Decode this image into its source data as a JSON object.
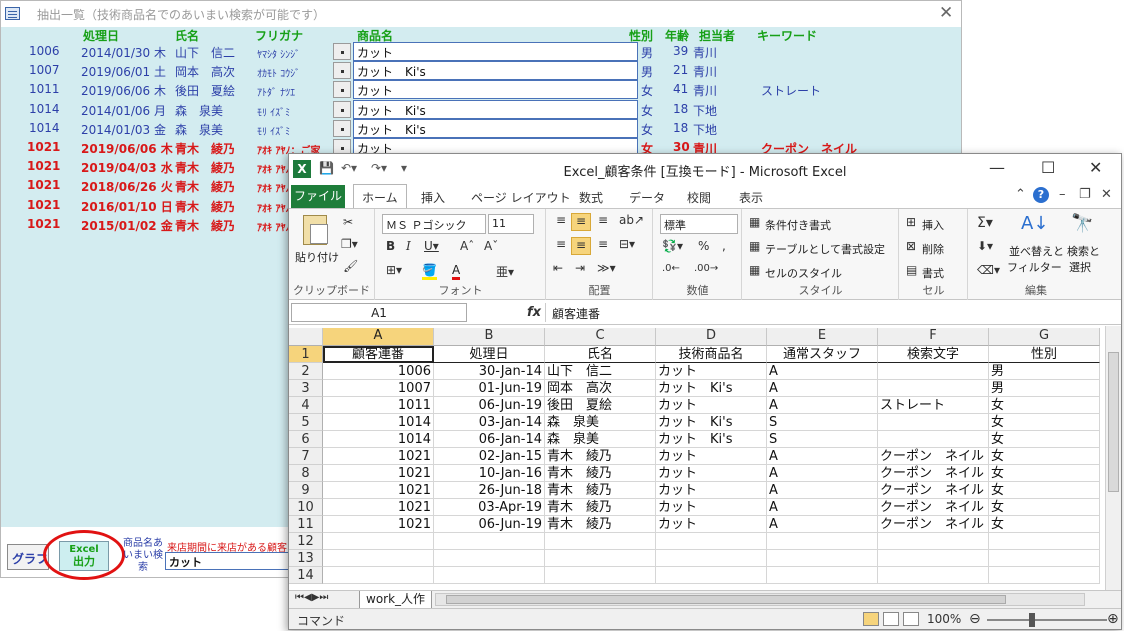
{
  "access": {
    "title": "抽出一覧（技術商品名でのあいまい検索が可能です）",
    "headers": {
      "date": "処理日",
      "name": "氏名",
      "kana": "フリガナ",
      "product": "商品名",
      "gender": "性別",
      "age": "年齢",
      "staff": "担当者",
      "keyword": "キーワード"
    },
    "rows": [
      {
        "id": "1006",
        "date": "2014/01/30 木",
        "name": "山下　信二",
        "kana": "ﾔﾏｼﾀ ｼﾝｼﾞ",
        "product": "カット",
        "gender": "男",
        "age": "39",
        "staff": "青川",
        "keyword": "",
        "style": "blue"
      },
      {
        "id": "1007",
        "date": "2019/06/01 土",
        "name": "岡本　高次",
        "kana": "ｵｶﾓﾄ ｺｳｼﾞ",
        "product": "カット　Ki's",
        "gender": "男",
        "age": "21",
        "staff": "青川",
        "keyword": "",
        "style": "blue"
      },
      {
        "id": "1011",
        "date": "2019/06/06 木",
        "name": "後田　夏絵",
        "kana": "ｱﾄﾀﾞ ﾅﾂｴ",
        "product": "カット",
        "gender": "女",
        "age": "41",
        "staff": "青川",
        "keyword": "ストレート",
        "style": "blue"
      },
      {
        "id": "1014",
        "date": "2014/01/06 月",
        "name": "森　泉美",
        "kana": "ﾓﾘ ｲｽﾞﾐ",
        "product": "カット　Ki's",
        "gender": "女",
        "age": "18",
        "staff": "下地",
        "keyword": "",
        "style": "blue"
      },
      {
        "id": "1014",
        "date": "2014/01/03 金",
        "name": "森　泉美",
        "kana": "ﾓﾘ ｲｽﾞﾐ",
        "product": "カット　Ki's",
        "gender": "女",
        "age": "18",
        "staff": "下地",
        "keyword": "",
        "style": "blue"
      },
      {
        "id": "1021",
        "date": "2019/06/06 木",
        "name": "青木　綾乃",
        "kana": "ｱｵｷ ｱﾔﾉ：ご家",
        "product": "カット",
        "gender": "女",
        "age": "30",
        "staff": "青川",
        "keyword": "クーポン　ネイル",
        "style": "red"
      },
      {
        "id": "1021",
        "date": "2019/04/03 水",
        "name": "青木　綾乃",
        "kana": "ｱｵｷ ｱﾔﾉ",
        "product": "",
        "gender": "",
        "age": "",
        "staff": "",
        "keyword": "",
        "style": "red"
      },
      {
        "id": "1021",
        "date": "2018/06/26 火",
        "name": "青木　綾乃",
        "kana": "ｱｵｷ ｱﾔﾉ",
        "product": "",
        "gender": "",
        "age": "",
        "staff": "",
        "keyword": "",
        "style": "red"
      },
      {
        "id": "1021",
        "date": "2016/01/10 日",
        "name": "青木　綾乃",
        "kana": "ｱｵｷ ｱﾔﾉ",
        "product": "",
        "gender": "",
        "age": "",
        "staff": "",
        "keyword": "",
        "style": "red"
      },
      {
        "id": "1021",
        "date": "2015/01/02 金",
        "name": "青木　綾乃",
        "kana": "ｱｵｷ ｱﾔﾉ",
        "product": "",
        "gender": "",
        "age": "",
        "staff": "",
        "keyword": "",
        "style": "red"
      }
    ],
    "footer": {
      "graph_label": "グラフ",
      "excel_label_line1": "Excel",
      "excel_label_line2": "出力",
      "side_label": "商品名あいまい検索",
      "note": "来店期間に来店がある顧客",
      "search_value": "カット"
    }
  },
  "excel": {
    "logo": "X",
    "title": "Excel_顧客条件 [互換モード] - Microsoft Excel",
    "tabs": [
      "ファイル",
      "ホーム",
      "挿入",
      "ページ レイアウト",
      "数式",
      "データ",
      "校閲",
      "表示"
    ],
    "ribbon": {
      "clipboard": {
        "label": "クリップボード",
        "paste": "貼り付け"
      },
      "font": {
        "label": "フォント",
        "font_name": "ＭＳ Ｐゴシック",
        "font_size": "11"
      },
      "alignment": {
        "label": "配置"
      },
      "number": {
        "label": "数値",
        "format": "標準"
      },
      "styles": {
        "label": "スタイル",
        "cond_format": "条件付き書式",
        "table_format": "テーブルとして書式設定",
        "cell_style": "セルのスタイル"
      },
      "cells": {
        "label": "セル",
        "insert": "挿入",
        "delete": "削除",
        "format": "書式"
      },
      "editing": {
        "label": "編集",
        "sort_filter_1": "並べ替えと",
        "sort_filter_2": "フィルター",
        "find_select_1": "検索と",
        "find_select_2": "選択"
      }
    },
    "namebox": "A1",
    "fx": "fx",
    "formula_value": "顧客連番",
    "columns": [
      "A",
      "B",
      "C",
      "D",
      "E",
      "F",
      "G"
    ],
    "row_numbers": [
      "1",
      "2",
      "3",
      "4",
      "5",
      "6",
      "7",
      "8",
      "9",
      "10",
      "11",
      "12",
      "13",
      "14"
    ],
    "header_row": [
      "顧客連番",
      "処理日",
      "氏名",
      "技術商品名",
      "通常スタッフ",
      "検索文字",
      "性別"
    ],
    "data_rows": [
      [
        "1006",
        "30-Jan-14",
        "山下　信二",
        "カット",
        "A",
        "",
        "男"
      ],
      [
        "1007",
        "01-Jun-19",
        "岡本　高次",
        "カット　Ki's",
        "A",
        "",
        "男"
      ],
      [
        "1011",
        "06-Jun-19",
        "後田　夏絵",
        "カット",
        "A",
        "ストレート",
        "女"
      ],
      [
        "1014",
        "03-Jan-14",
        "森　泉美",
        "カット　Ki's",
        "S",
        "",
        "女"
      ],
      [
        "1014",
        "06-Jan-14",
        "森　泉美",
        "カット　Ki's",
        "S",
        "",
        "女"
      ],
      [
        "1021",
        "02-Jan-15",
        "青木　綾乃",
        "カット",
        "A",
        "クーポン　ネイル",
        "女"
      ],
      [
        "1021",
        "10-Jan-16",
        "青木　綾乃",
        "カット",
        "A",
        "クーポン　ネイル",
        "女"
      ],
      [
        "1021",
        "26-Jun-18",
        "青木　綾乃",
        "カット",
        "A",
        "クーポン　ネイル",
        "女"
      ],
      [
        "1021",
        "03-Apr-19",
        "青木　綾乃",
        "カット",
        "A",
        "クーポン　ネイル",
        "女"
      ],
      [
        "1021",
        "06-Jun-19",
        "青木　綾乃",
        "カット",
        "A",
        "クーポン　ネイル",
        "女"
      ]
    ],
    "sheet_tab": "work_人作",
    "status_text": "コマンド",
    "zoom": "100%"
  },
  "colors": {
    "access_bg": "#d3ecf0",
    "header_green": "#17a017",
    "row_blue": "#2c3fa8",
    "row_red": "#d81919",
    "excel_green": "#1e7d3a",
    "selection_gold": "#f6d47c",
    "highlight_circle": "#e11212"
  },
  "icons": [
    "form-icon",
    "close-icon",
    "excel-logo-icon",
    "save-icon",
    "undo-icon",
    "redo-icon",
    "minimize-icon",
    "maximize-icon",
    "help-icon",
    "paste-icon",
    "cut-icon",
    "copy-icon",
    "format-painter-icon",
    "bold-icon",
    "italic-icon",
    "underline-icon",
    "sum-icon",
    "sort-filter-icon",
    "find-icon"
  ]
}
